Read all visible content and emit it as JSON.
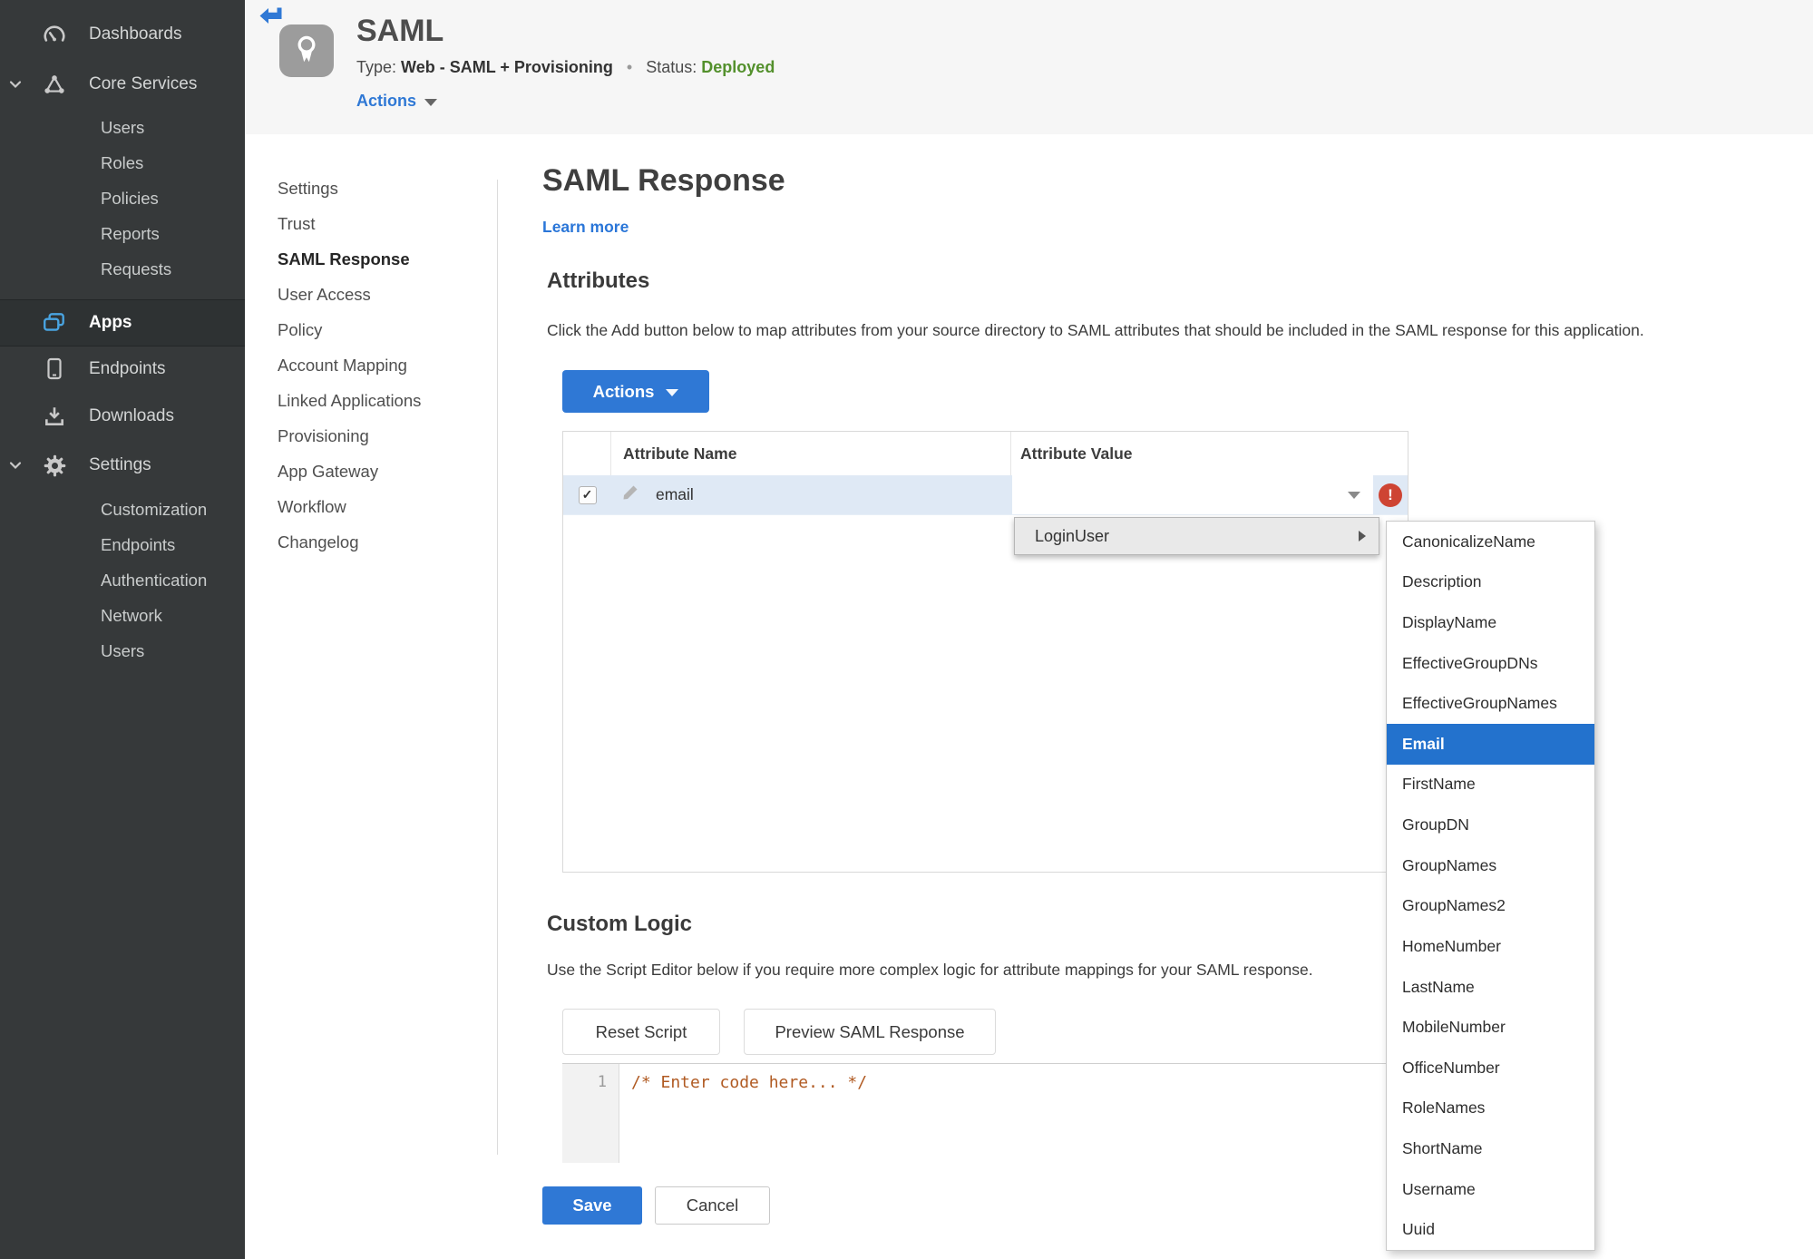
{
  "icons": {
    "check": "✓",
    "exclamation": "!"
  },
  "colors": {
    "accent_blue": "#2f78d5",
    "selected_blue": "#2372cd",
    "status_green": "#53902c",
    "error_red": "#ce4433",
    "sidebar_bg": "#36393a",
    "row_highlight": "#dfe9f5"
  },
  "sidebar": {
    "items": {
      "dashboards": "Dashboards",
      "core_services": "Core Services",
      "apps": "Apps",
      "endpoints": "Endpoints",
      "downloads": "Downloads",
      "settings": "Settings"
    },
    "core_children": [
      "Users",
      "Roles",
      "Policies",
      "Reports",
      "Requests"
    ],
    "settings_children": [
      "Customization",
      "Endpoints",
      "Authentication",
      "Network",
      "Users"
    ]
  },
  "header": {
    "title": "SAML",
    "type_label": "Type:",
    "type_value": "Web - SAML + Provisioning",
    "dot": "•",
    "status_label": "Status:",
    "status_value": "Deployed",
    "actions_label": "Actions"
  },
  "subnav": {
    "items": [
      "Settings",
      "Trust",
      "SAML Response",
      "User Access",
      "Policy",
      "Account Mapping",
      "Linked Applications",
      "Provisioning",
      "App Gateway",
      "Workflow",
      "Changelog"
    ],
    "active": "SAML Response"
  },
  "main": {
    "title": "SAML Response",
    "learn_more": "Learn more",
    "attributes_heading": "Attributes",
    "attributes_description": "Click the Add button below to map attributes from your source directory to SAML attributes that should be included in the SAML response for this application.",
    "actions_button": "Actions",
    "table": {
      "columns": [
        "Attribute Name",
        "Attribute Value"
      ],
      "rows": [
        {
          "name": "email",
          "checked": true,
          "value": ""
        }
      ]
    },
    "custom_logic_heading": "Custom Logic",
    "custom_logic_description": "Use the Script Editor below if you require more complex logic for attribute mappings for your SAML response.",
    "reset_button": "Reset Script",
    "preview_button": "Preview SAML Response",
    "editor": {
      "line_number": "1",
      "code": "/* Enter code here... */"
    },
    "save_button": "Save",
    "cancel_button": "Cancel"
  },
  "dropdown": {
    "parent": "LoginUser",
    "selected": "Email",
    "options": [
      "CanonicalizeName",
      "Description",
      "DisplayName",
      "EffectiveGroupDNs",
      "EffectiveGroupNames",
      "Email",
      "FirstName",
      "GroupDN",
      "GroupNames",
      "GroupNames2",
      "HomeNumber",
      "LastName",
      "MobileNumber",
      "OfficeNumber",
      "RoleNames",
      "ShortName",
      "Username",
      "Uuid"
    ]
  }
}
